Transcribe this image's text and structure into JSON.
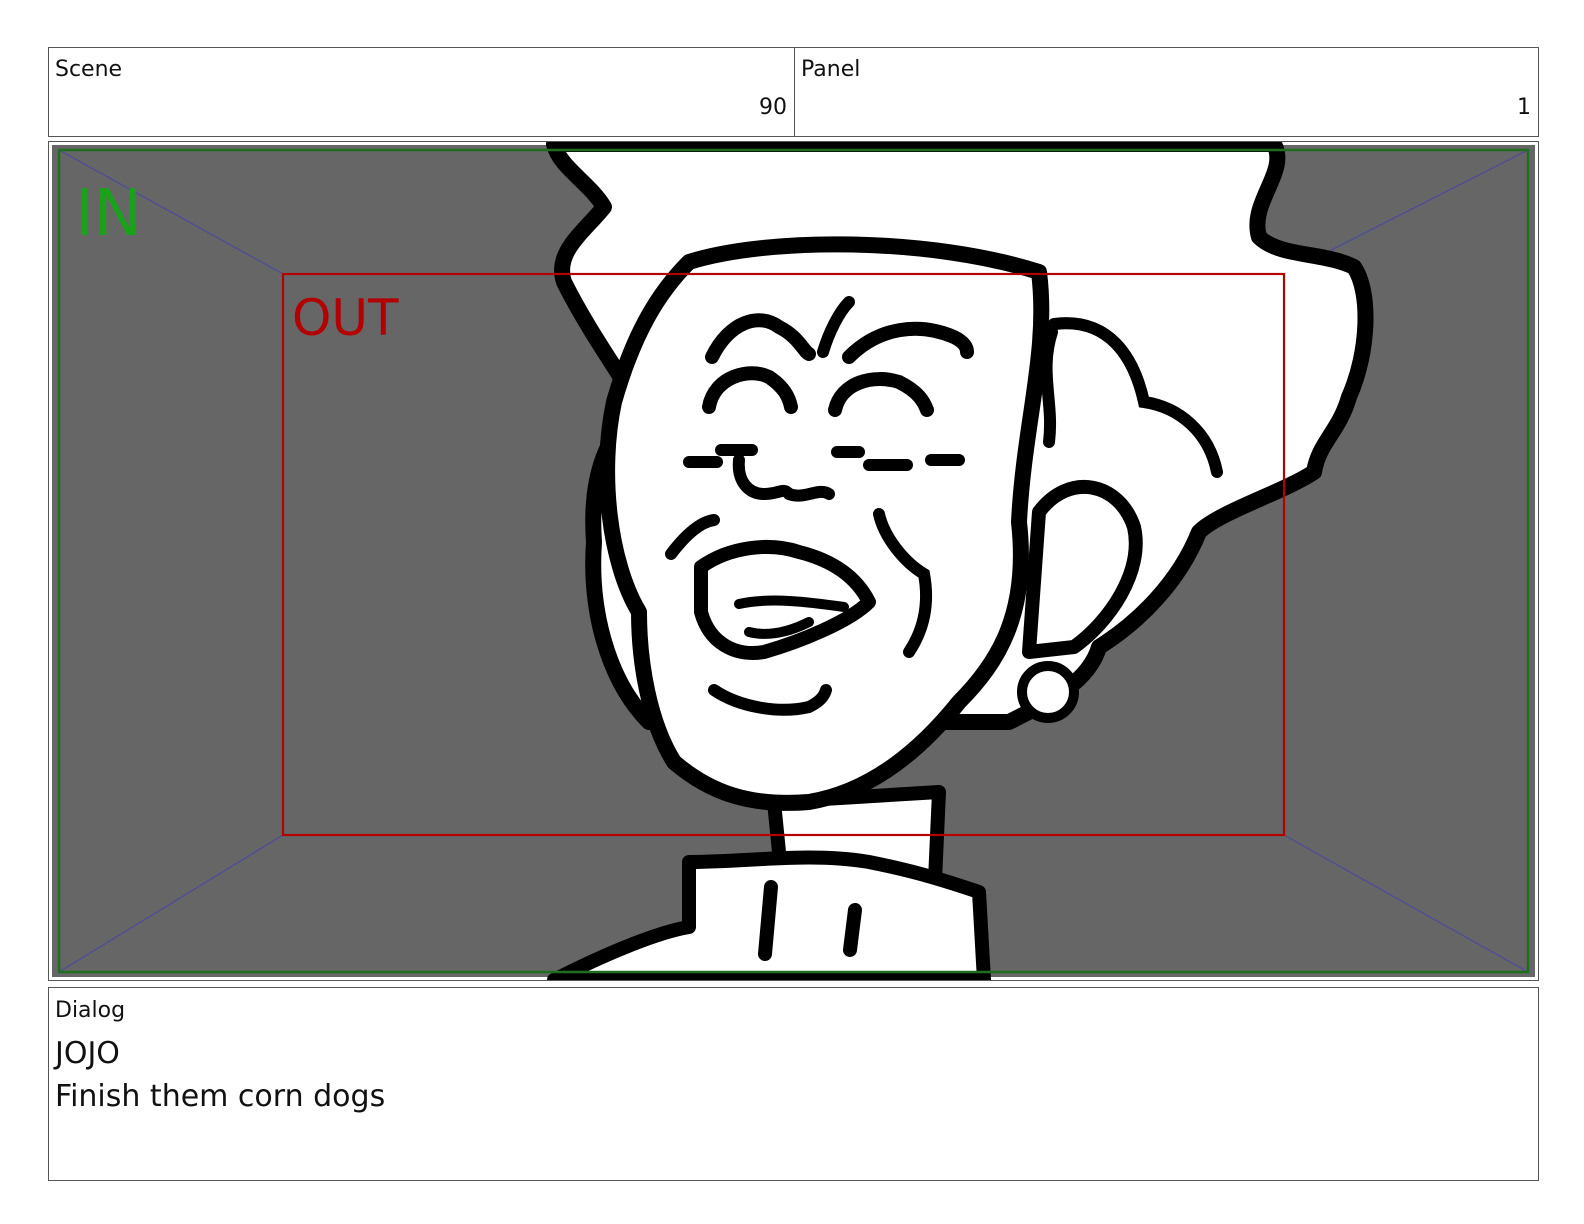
{
  "header": {
    "scene_label": "Scene",
    "scene_value": "90",
    "panel_label": "Panel",
    "panel_value": "1"
  },
  "frame": {
    "in_label": "IN",
    "out_label": "OUT",
    "in_color": "#1aa31a",
    "out_color": "#b30000",
    "background_color": "#666666"
  },
  "dialog": {
    "label": "Dialog",
    "speaker": "JOJO",
    "line": "Finish them corn dogs"
  }
}
